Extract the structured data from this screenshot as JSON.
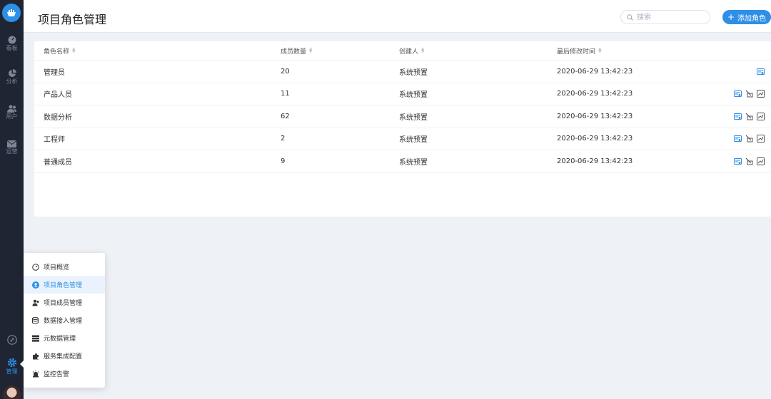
{
  "header": {
    "title": "项目角色管理",
    "search_placeholder": "搜索",
    "add_button_label": "添加角色"
  },
  "sidebar": {
    "items": [
      {
        "label": "看板",
        "icon": "dashboard-icon"
      },
      {
        "label": "分析",
        "icon": "pie-chart-icon"
      },
      {
        "label": "用户",
        "icon": "users-icon"
      },
      {
        "label": "运营",
        "icon": "mail-icon"
      },
      {
        "label": "",
        "icon": "plugin-icon"
      },
      {
        "label": "管理",
        "icon": "gear-icon",
        "active": true
      }
    ]
  },
  "table": {
    "columns": [
      "角色名称",
      "成员数量",
      "创建人",
      "最后修改时间"
    ],
    "rows": [
      {
        "name": "管理员",
        "count": "20",
        "creator": "系统预置",
        "modified": "2020-06-29 13:42:23"
      },
      {
        "name": "产品人员",
        "count": "11",
        "creator": "系统预置",
        "modified": "2020-06-29 13:42:23"
      },
      {
        "name": "数据分析",
        "count": "62",
        "creator": "系统预置",
        "modified": "2020-06-29 13:42:23"
      },
      {
        "name": "工程师",
        "count": "2",
        "creator": "系统预置",
        "modified": "2020-06-29 13:42:23"
      },
      {
        "name": "普通成员",
        "count": "9",
        "creator": "系统预置",
        "modified": "2020-06-29 13:42:23"
      }
    ]
  },
  "menu": {
    "items": [
      {
        "label": "项目概览",
        "icon": "overview-icon"
      },
      {
        "label": "项目角色管理",
        "icon": "role-icon",
        "selected": true
      },
      {
        "label": "项目成员管理",
        "icon": "members-icon"
      },
      {
        "label": "数据接入管理",
        "icon": "data-access-icon"
      },
      {
        "label": "元数据管理",
        "icon": "metadata-icon"
      },
      {
        "label": "服务集成配置",
        "icon": "integration-icon"
      },
      {
        "label": "监控告警",
        "icon": "alarm-icon"
      }
    ]
  },
  "colors": {
    "accent": "#2d8fe6",
    "sidebar_bg": "#1f2533",
    "page_bg": "#eef1f6"
  }
}
